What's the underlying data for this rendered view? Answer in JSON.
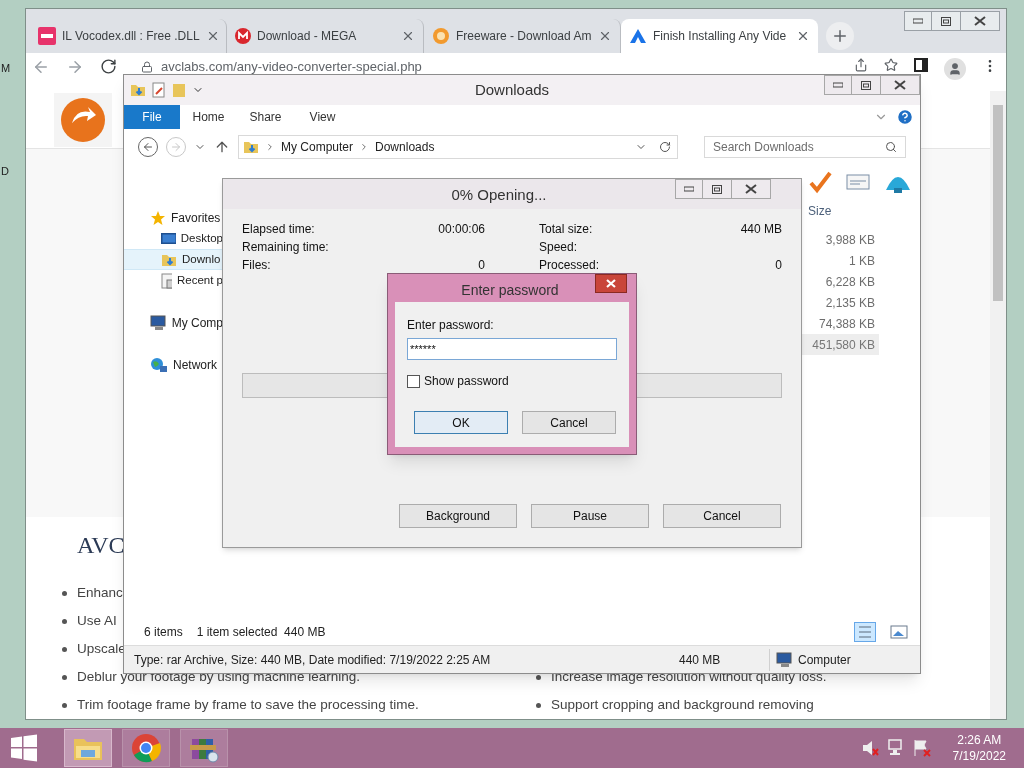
{
  "desktop": {
    "labels": [
      "M",
      "D"
    ]
  },
  "browser": {
    "tabs": [
      {
        "title": "IL Vocodex.dll : Free .DLL",
        "kind": "dll",
        "selected": false
      },
      {
        "title": "Download - MEGA",
        "kind": "mega",
        "selected": false
      },
      {
        "title": "Freeware - Download Am",
        "kind": "orange",
        "selected": false
      },
      {
        "title": "Finish Installing Any Vide",
        "kind": "triangle",
        "selected": true
      }
    ],
    "url": "avclabs.com/any-video-converter-special.php",
    "page": {
      "heading": "AVC",
      "rows": [
        {
          "left": "Enhanc"
        },
        {
          "left": "Use AI"
        },
        {
          "left": "Upscale"
        },
        {
          "left": "Deblur your footage by using machine learning.",
          "right": "Increase image resolution without quality loss."
        },
        {
          "left": "Trim footage frame by frame to save the processing time.",
          "right": "Support cropping and background removing"
        }
      ]
    }
  },
  "explorer": {
    "title": "Downloads",
    "ribbon_tabs": [
      {
        "label": "File",
        "kind": "file"
      },
      {
        "label": "Home",
        "kind": "tab"
      },
      {
        "label": "Share",
        "kind": "tab"
      },
      {
        "label": "View",
        "kind": "tab"
      }
    ],
    "breadcrumb": [
      "My Computer",
      "Downloads"
    ],
    "search": {
      "placeholder": "Search Downloads"
    },
    "nav": [
      {
        "label": "Favorites",
        "kind": "star",
        "children": [
          {
            "label": "Desktop",
            "kind": "desktop",
            "selected": false
          },
          {
            "label": "Downlo",
            "kind": "downloads",
            "selected": true
          },
          {
            "label": "Recent p",
            "kind": "recent",
            "selected": false
          }
        ]
      },
      {
        "label": "My Comp",
        "kind": "computer"
      },
      {
        "label": "Network",
        "kind": "network"
      }
    ],
    "size_header": "Size",
    "sizes": [
      {
        "value": "3,988 KB",
        "selected": false
      },
      {
        "value": "1 KB",
        "selected": false
      },
      {
        "value": "6,228 KB",
        "selected": false
      },
      {
        "value": "2,135 KB",
        "selected": false
      },
      {
        "value": "74,388 KB",
        "selected": false
      },
      {
        "value": "451,580 KB",
        "selected": true
      }
    ],
    "item_count": "6 items",
    "selection": "1 item selected  440 MB",
    "details": "Type: rar Archive, Size: 440 MB, Date modified: 7/19/2022 2:25 AM",
    "details_size": "440 MB",
    "details_location": "Computer"
  },
  "progress_dialog": {
    "title": "0% Opening...",
    "left_fields": [
      {
        "label": "Elapsed time:",
        "value": "00:00:06"
      },
      {
        "label": "Remaining time:"
      },
      {
        "label": "Files:",
        "value": "0"
      }
    ],
    "right_fields": [
      {
        "label": "Total size:",
        "value": "440 MB"
      },
      {
        "label": "Speed:"
      },
      {
        "label": "Processed:",
        "value": "0"
      }
    ],
    "progress": {
      "level": 0
    },
    "buttons": [
      "Background",
      "Pause",
      "Cancel"
    ]
  },
  "password_dialog": {
    "title": "Enter password",
    "label": "Enter password:",
    "value": "******",
    "show_password": {
      "label": "Show password",
      "checked": false
    },
    "buttons": [
      {
        "label": "OK",
        "focused": true
      },
      {
        "label": "Cancel",
        "focused": false
      }
    ]
  },
  "taskbar": {
    "apps": [
      {
        "kind": "explorer",
        "selected": true
      },
      {
        "kind": "chrome",
        "selected": false
      },
      {
        "kind": "winrar",
        "selected": false
      }
    ],
    "time": "2:26 AM",
    "date": "7/19/2022"
  }
}
